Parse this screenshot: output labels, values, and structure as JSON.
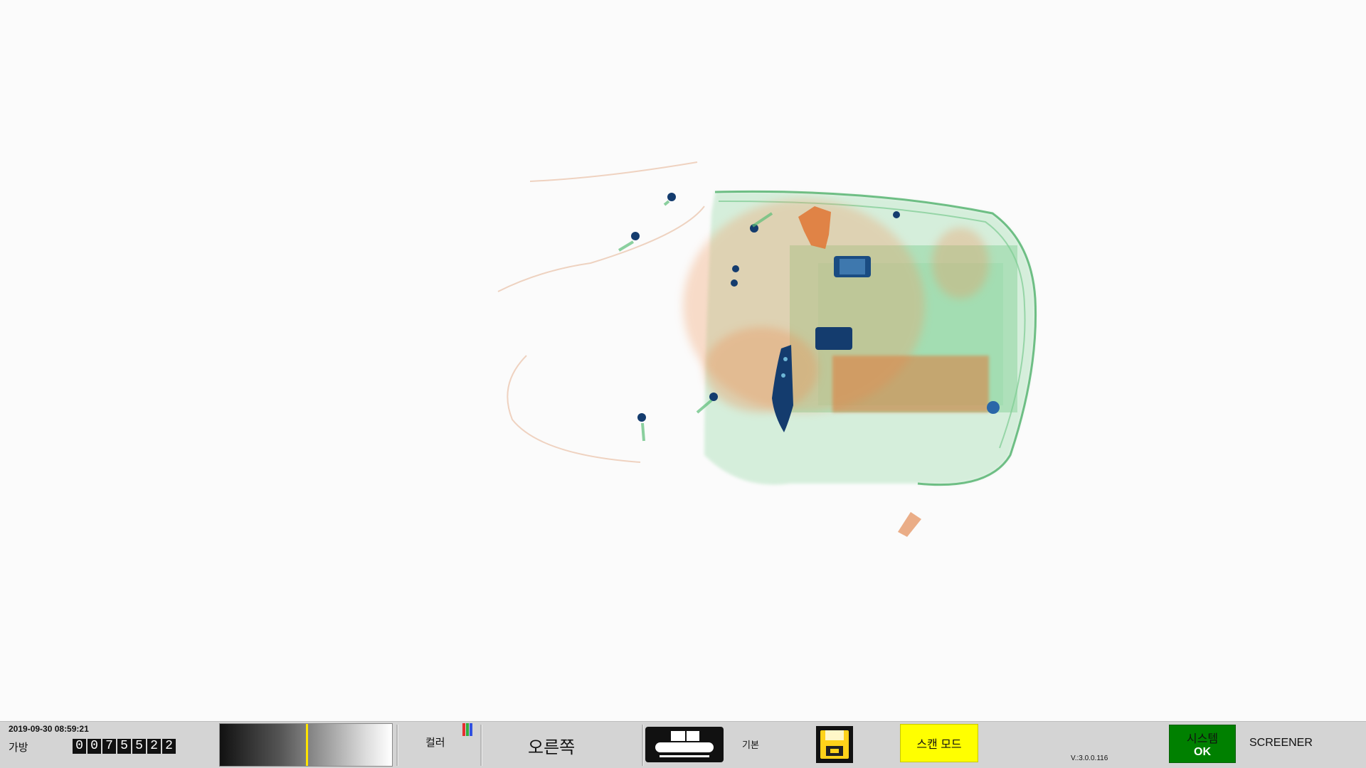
{
  "status": {
    "datetime": "2019-09-30 08:59:21",
    "bag_label": "가방",
    "bag_count_digits": [
      "0",
      "0",
      "7",
      "5",
      "5",
      "2",
      "2"
    ],
    "gray_level": 0.5,
    "color_label": "컬러",
    "direction_label": "오른쪽",
    "conveyor_icon": "conveyor-belt-icon",
    "basic_label": "기본",
    "save_icon": "floppy-disk-icon",
    "scan_mode_label": "스캔 모드",
    "version": "V.:3.0.0.116",
    "system_label": "시스템",
    "system_status": "OK",
    "user_role": "SCREENER"
  },
  "colors": {
    "status_bar_bg": "#d4d4d4",
    "scan_mode_bg": "#ffff00",
    "system_ok_bg": "#008000",
    "gray_marker": "#ffe500",
    "xray_organic": "#e07a3a",
    "xray_inorganic": "#4fb06a",
    "xray_metal": "#143c6e"
  },
  "xray": {
    "icons": [
      "bag-outline",
      "zipper-pull-icon",
      "knife-icon",
      "battery-icon",
      "camera-icon",
      "coins-icon"
    ]
  }
}
